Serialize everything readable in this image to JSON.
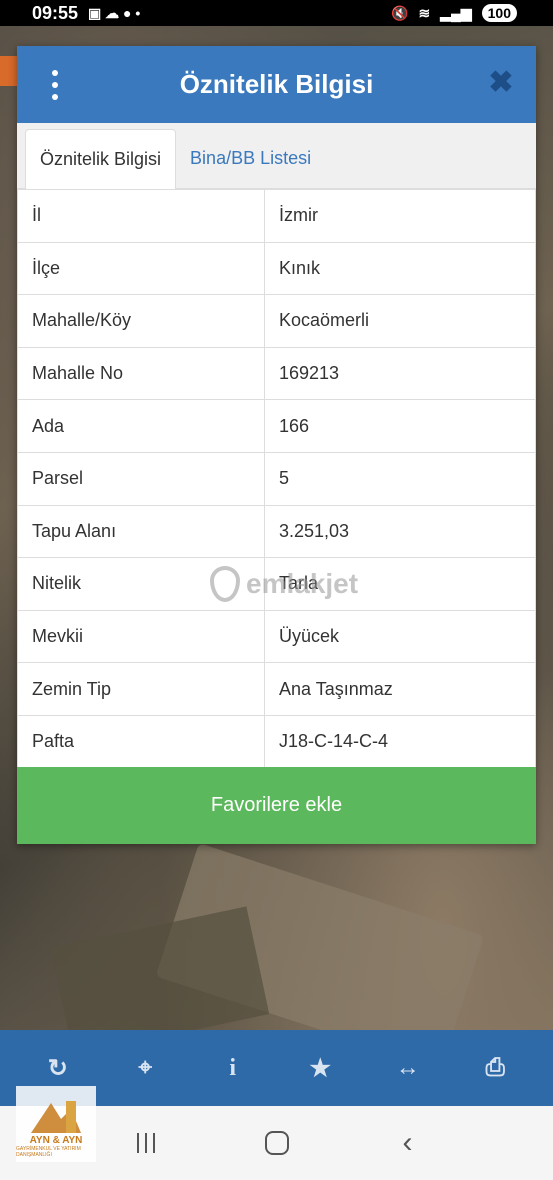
{
  "status_bar": {
    "time": "09:55",
    "battery": "100"
  },
  "dialog": {
    "title": "Öznitelik Bilgisi",
    "tabs": [
      {
        "label": "Öznitelik Bilgisi",
        "active": true
      },
      {
        "label": "Bina/BB Listesi",
        "active": false
      }
    ],
    "rows": [
      {
        "key": "İl",
        "value": "İzmir"
      },
      {
        "key": "İlçe",
        "value": "Kınık"
      },
      {
        "key": "Mahalle/Köy",
        "value": "Kocaömerli"
      },
      {
        "key": "Mahalle No",
        "value": "169213"
      },
      {
        "key": "Ada",
        "value": "166"
      },
      {
        "key": "Parsel",
        "value": "5"
      },
      {
        "key": "Tapu Alanı",
        "value": "3.251,03"
      },
      {
        "key": "Nitelik",
        "value": "Tarla"
      },
      {
        "key": "Mevkii",
        "value": "Üyücek"
      },
      {
        "key": "Zemin Tip",
        "value": "Ana Taşınmaz"
      },
      {
        "key": "Pafta",
        "value": "J18-C-14-C-4"
      }
    ],
    "favorite_button": "Favorilere ekle"
  },
  "watermark": "emlakjet",
  "logo": {
    "name": "AYN & AYN",
    "subtitle": "GAYRİMENKUL VE YATIRIM DANIŞMANLIĞI"
  },
  "toolbar": {
    "icons": [
      "refresh-icon",
      "crosshair-icon",
      "info-icon",
      "star-icon",
      "measure-icon",
      "print-icon"
    ]
  },
  "colors": {
    "header": "#3a79bd",
    "favorite": "#5cb85c",
    "toolbar": "#2f6aa8"
  }
}
